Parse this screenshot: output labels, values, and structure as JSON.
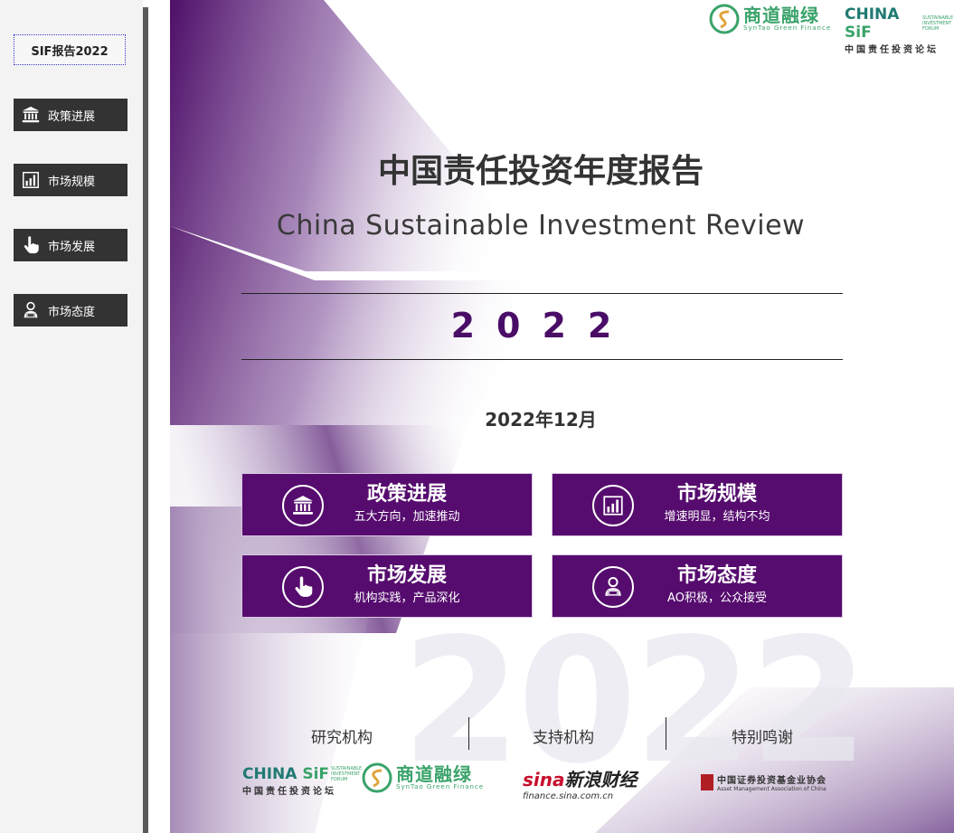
{
  "sidebar": {
    "brand": "SIF报告2022",
    "items": [
      {
        "label": "政策进展",
        "icon": "bank-icon"
      },
      {
        "label": "市场规模",
        "icon": "bar-chart-icon"
      },
      {
        "label": "市场发展",
        "icon": "pointing-hand-icon"
      },
      {
        "label": "市场态度",
        "icon": "person-laptop-icon"
      }
    ]
  },
  "header_logos": {
    "syntao": {
      "cn": "商道融绿",
      "en": "SynTao Green Finance"
    },
    "china_sif": {
      "main_a": "CHINA ",
      "main_b": "SiF",
      "mini": "SUSTAINABLE INVESTMENT FORUM",
      "cn": "中国责任投资论坛"
    }
  },
  "cover": {
    "title_cn": "中国责任投资年度报告",
    "title_en": "China Sustainable Investment Review",
    "year": "2022",
    "date": "2022年12月",
    "watermark": "2022",
    "cards": [
      {
        "title": "政策进展",
        "subtitle": "五大方向，加速推动",
        "icon": "bank-icon"
      },
      {
        "title": "市场规模",
        "subtitle": "增速明显，结构不均",
        "icon": "bar-chart-icon"
      },
      {
        "title": "市场发展",
        "subtitle": "机构实践，产品深化",
        "icon": "pointing-hand-icon"
      },
      {
        "title": "市场态度",
        "subtitle": "AO积极，公众接受",
        "icon": "person-laptop-icon"
      }
    ]
  },
  "footer": {
    "research_label": "研究机构",
    "support_label": "支持机构",
    "thanks_label": "特别鸣谢",
    "sina": {
      "name_a": "sina",
      "name_b": "新浪财经",
      "url": "finance.sina.com.cn"
    },
    "amac": {
      "cn": "中国证券投资基金业协会",
      "en": "Asset Management Association of China"
    }
  },
  "colors": {
    "accent": "#560c6e",
    "year": "#4a0d67",
    "green": "#3aa36a",
    "teal": "#1f7a73"
  }
}
